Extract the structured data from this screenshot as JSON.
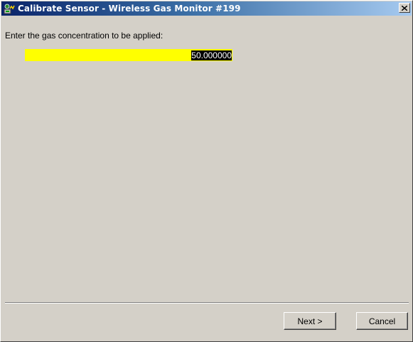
{
  "window": {
    "title": "Calibrate Sensor - Wireless Gas Monitor #199",
    "icon": "gas-monitor-app-icon",
    "close_glyph": "✕"
  },
  "form": {
    "prompt": "Enter the gas concentration to be applied:",
    "concentration_value": "50.000000"
  },
  "buttons": {
    "next_label": "Next >",
    "cancel_label": "Cancel"
  },
  "colors": {
    "input_highlight": "#ffff00",
    "dialog_face": "#d4d0c8",
    "title_active_start": "#0a246a",
    "title_active_end": "#a6caf0"
  }
}
